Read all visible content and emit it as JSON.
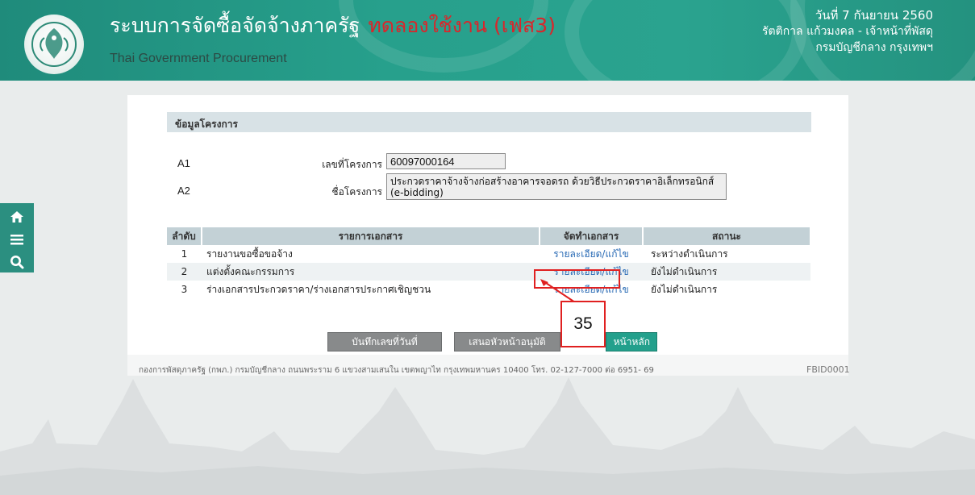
{
  "header": {
    "title_th": "ระบบการจัดซื้อจัดจ้างภาครัฐ",
    "title_trial": "ทดลองใช้งาน (เฟส3)",
    "title_en": "Thai Government Procurement",
    "date": "วันที่ 7 กันยายน 2560",
    "user": "รัตติกาล แก้วมงคล - เจ้าหน้าที่พัสดุ",
    "org": "กรมบัญชีกลาง กรุงเทพฯ"
  },
  "sidenav": {
    "home_icon": "home-icon",
    "menu_icon": "menu-icon",
    "search_icon": "search-icon"
  },
  "project": {
    "section_title": "ข้อมูลโครงการ",
    "a1_code": "A1",
    "a1_label": "เลขที่โครงการ",
    "a1_value": "60097000164",
    "a2_code": "A2",
    "a2_label": "ชื่อโครงการ",
    "a2_value": "ประกวดราคาจ้างจ้างก่อสร้างอาคารจอดรถ ด้วยวิธีประกวดราคาอิเล็กทรอนิกส์ (e-bidding)"
  },
  "table": {
    "headers": [
      "ลำดับ",
      "รายการเอกสาร",
      "จัดทำเอกสาร",
      "สถานะ"
    ],
    "rows": [
      {
        "no": "1",
        "name": "รายงานขอซื้อขอจ้าง",
        "action": "รายละเอียด/แก้ไข",
        "status": "ระหว่างดำเนินการ"
      },
      {
        "no": "2",
        "name": "แต่งตั้งคณะกรรมการ",
        "action": "รายละเอียด/แก้ไข",
        "status": "ยังไม่ดำเนินการ"
      },
      {
        "no": "3",
        "name": "ร่างเอกสารประกวดราคา/ร่างเอกสารประกาศเชิญชวน",
        "action": "รายละเอียด/แก้ไข",
        "status": "ยังไม่ดำเนินการ"
      }
    ]
  },
  "callout": {
    "number": "35"
  },
  "buttons": {
    "save_number_date": "บันทึกเลขที่วันที่",
    "propose_to_head": "เสนอหัวหน้าอนุมัติ",
    "main_page": "หน้าหลัก"
  },
  "footer": {
    "address": "กองการพัสดุภาครัฐ (กพภ.) กรมบัญชีกลาง ถนนพระราม 6 แขวงสามเสนใน เขตพญาไท กรุงเทพมหานคร 10400 โทร. 02-127-7000 ต่อ 6951- 69",
    "page_code": "FBID0001"
  },
  "colors": {
    "header_bg": "#27a08c",
    "trial_red": "#d9262b",
    "link_blue": "#2a6bb5",
    "highlight_red": "#e02020",
    "button_gray": "#888a8b",
    "button_green": "#23a08c"
  }
}
